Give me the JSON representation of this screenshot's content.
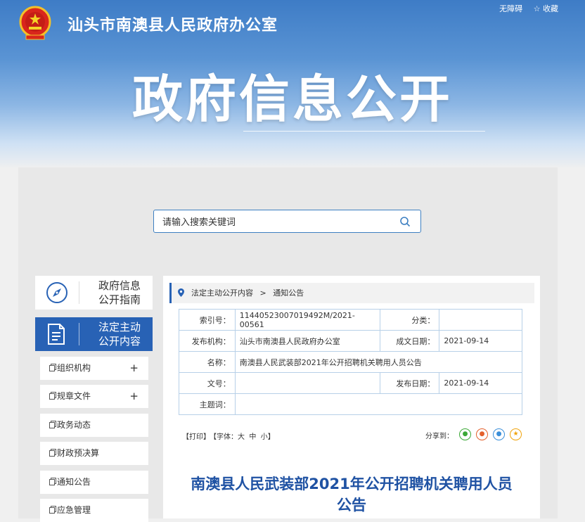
{
  "header": {
    "site_title": "汕头市南澳县人民政府办公室",
    "links": {
      "accessibility": "无障碍",
      "favorite_star": "☆",
      "favorite": "收藏"
    },
    "banner_title": "政府信息公开"
  },
  "search": {
    "placeholder": "请输入搜索关键词"
  },
  "sidebar": {
    "guide": {
      "line1": "政府信息",
      "line2": "公开指南"
    },
    "active_category": {
      "line1": "法定主动",
      "line2": "公开内容"
    },
    "items": [
      {
        "label": "组织机构",
        "expand": "+"
      },
      {
        "label": "规章文件",
        "expand": "+"
      },
      {
        "label": "政务动态"
      },
      {
        "label": "财政预决算"
      },
      {
        "label": "通知公告"
      },
      {
        "label": "应急管理"
      }
    ]
  },
  "breadcrumb": {
    "parent": "法定主动公开内容",
    "sep": ">",
    "current": "通知公告"
  },
  "meta": {
    "index_label": "索引号：",
    "index_value": "11440523007019492M/2021-00561",
    "category_label": "分类：",
    "category_value": "",
    "publisher_label": "发布机构：",
    "publisher_value": "汕头市南澳县人民政府办公室",
    "written_label": "成文日期：",
    "written_value": "2021-09-14",
    "name_label": "名称：",
    "name_value": "南澳县人民武装部2021年公开招聘机关聘用人员公告",
    "docno_label": "文号：",
    "docno_value": "",
    "published_label": "发布日期：",
    "published_value": "2021-09-14",
    "subject_label": "主题词：",
    "subject_value": ""
  },
  "tools": {
    "print": "【打印】",
    "font_prefix": "【字体：",
    "font_large": "大",
    "font_medium": "中",
    "font_small": "小",
    "font_suffix": "】",
    "share_label": "分享到："
  },
  "colors": {
    "primary_blue": "#2862b5",
    "title_blue": "#1f52a3",
    "wechat": "#3aa835",
    "weibo": "#e4602c",
    "qq": "#3b8fd9",
    "qzone": "#f0a30a"
  },
  "article": {
    "title_line1": "南澳县人民武装部2021年公开招聘机关聘用人员",
    "title_line2": "公告"
  }
}
